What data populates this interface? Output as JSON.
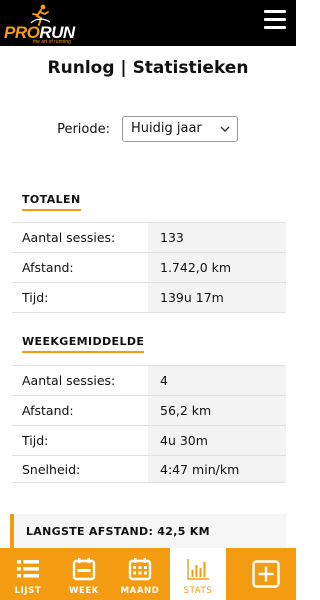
{
  "header": {
    "logo_pro": "PRO",
    "logo_run": "RUN",
    "logo_tagline": "the art of running",
    "menu_icon": "hamburger-menu-icon"
  },
  "title": "Runlog | Statistieken",
  "period": {
    "label": "Periode:",
    "selected": "Huidig jaar"
  },
  "totals": {
    "heading": "TOTALEN",
    "rows": [
      {
        "label": "Aantal sessies:",
        "value": "133"
      },
      {
        "label": "Afstand:",
        "value": "1.742,0 km"
      },
      {
        "label": "Tijd:",
        "value": "139u 17m"
      }
    ]
  },
  "weekly": {
    "heading": "WEEKGEMIDDELDE",
    "rows": [
      {
        "label": "Aantal sessies:",
        "value": "4"
      },
      {
        "label": "Afstand:",
        "value": "56,2 km"
      },
      {
        "label": "Tijd:",
        "value": "4u 30m"
      },
      {
        "label": "Snelheid:",
        "value": "4:47 min/km"
      }
    ]
  },
  "highlight": {
    "text": "LANGSTE AFSTAND: 42,5 KM"
  },
  "tabs": [
    {
      "label": "LIJST",
      "icon": "list-icon"
    },
    {
      "label": "WEEK",
      "icon": "week-icon"
    },
    {
      "label": "MAAND",
      "icon": "calendar-icon"
    },
    {
      "label": "STATS",
      "icon": "bar-chart-icon",
      "active": true
    }
  ],
  "add_icon": "add-plus-icon",
  "colors": {
    "accent": "#f39c12",
    "header_bg": "#000000",
    "value_bg": "#f3f3f3"
  }
}
